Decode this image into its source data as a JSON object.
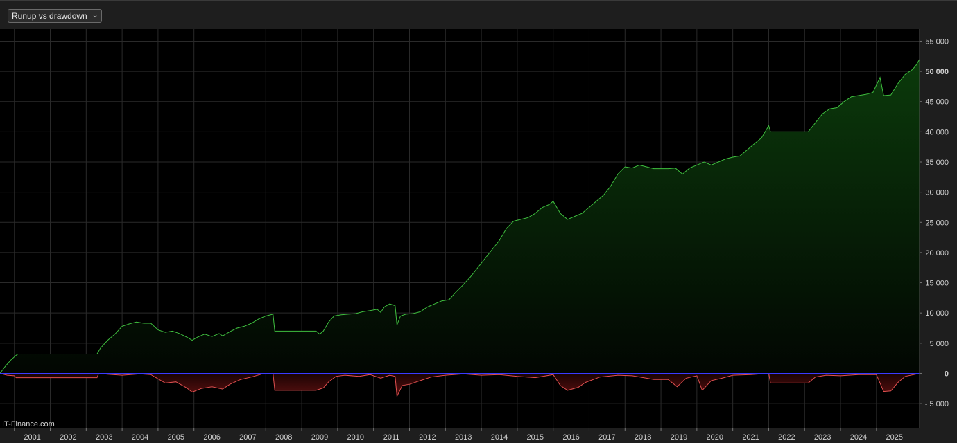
{
  "toolbar": {
    "dropdown_value": "Runup vs drawdown"
  },
  "watermark": "IT-Finance.com",
  "colors": {
    "runup": "#3fbf3f",
    "drawdown": "#e05050",
    "zero_line": "#3a3aff",
    "grid": "#2a2a2a"
  },
  "chart_data": {
    "type": "area",
    "title": "",
    "xlabel": "",
    "ylabel": "",
    "x_ticks": [
      "2001",
      "2002",
      "2003",
      "2004",
      "2005",
      "2006",
      "2007",
      "2008",
      "2009",
      "2010",
      "2011",
      "2012",
      "2013",
      "2014",
      "2015",
      "2016",
      "2017",
      "2018",
      "2019",
      "2020",
      "2021",
      "2022",
      "2023",
      "2024",
      "2025"
    ],
    "y_ticks": [
      {
        "value": 55000,
        "label": "55 000"
      },
      {
        "value": 50000,
        "label": "50 000"
      },
      {
        "value": 45000,
        "label": "45 000"
      },
      {
        "value": 40000,
        "label": "40 000"
      },
      {
        "value": 35000,
        "label": "35 000"
      },
      {
        "value": 30000,
        "label": "30 000"
      },
      {
        "value": 25000,
        "label": "25 000"
      },
      {
        "value": 20000,
        "label": "20 000"
      },
      {
        "value": 15000,
        "label": "15 000"
      },
      {
        "value": 10000,
        "label": "10 000"
      },
      {
        "value": 5000,
        "label": "5 000"
      },
      {
        "value": 0,
        "label": "0"
      },
      {
        "value": -5000,
        "label": "- 5 000"
      }
    ],
    "xlim": [
      2000.6,
      2026.2
    ],
    "ylim": [
      -9000,
      57000
    ],
    "grid": true,
    "legend": "none",
    "series": [
      {
        "values": [
          [
            2000.6,
            0
          ],
          [
            2000.75,
            1200
          ],
          [
            2000.9,
            2200
          ],
          [
            2001.05,
            3000
          ],
          [
            2001.1,
            3200
          ],
          [
            2003.3,
            3200
          ],
          [
            2003.4,
            4200
          ],
          [
            2003.6,
            5500
          ],
          [
            2003.8,
            6500
          ],
          [
            2004.0,
            7800
          ],
          [
            2004.2,
            8200
          ],
          [
            2004.4,
            8500
          ],
          [
            2004.6,
            8300
          ],
          [
            2004.8,
            8300
          ],
          [
            2005.0,
            7200
          ],
          [
            2005.2,
            6800
          ],
          [
            2005.4,
            7000
          ],
          [
            2005.6,
            6600
          ],
          [
            2005.8,
            6000
          ],
          [
            2005.95,
            5500
          ],
          [
            2006.1,
            6000
          ],
          [
            2006.3,
            6500
          ],
          [
            2006.5,
            6100
          ],
          [
            2006.7,
            6600
          ],
          [
            2006.8,
            6200
          ],
          [
            2007.0,
            6900
          ],
          [
            2007.2,
            7500
          ],
          [
            2007.4,
            7800
          ],
          [
            2007.6,
            8300
          ],
          [
            2007.8,
            9000
          ],
          [
            2008.0,
            9500
          ],
          [
            2008.2,
            9800
          ],
          [
            2008.25,
            7000
          ],
          [
            2009.4,
            7000
          ],
          [
            2009.5,
            6500
          ],
          [
            2009.6,
            7000
          ],
          [
            2009.75,
            8500
          ],
          [
            2009.9,
            9500
          ],
          [
            2010.1,
            9700
          ],
          [
            2010.3,
            9800
          ],
          [
            2010.5,
            9900
          ],
          [
            2010.7,
            10200
          ],
          [
            2010.9,
            10400
          ],
          [
            2011.1,
            10600
          ],
          [
            2011.2,
            10100
          ],
          [
            2011.3,
            11000
          ],
          [
            2011.45,
            11500
          ],
          [
            2011.6,
            11200
          ],
          [
            2011.65,
            8000
          ],
          [
            2011.75,
            9500
          ],
          [
            2011.9,
            9800
          ],
          [
            2012.1,
            9900
          ],
          [
            2012.3,
            10200
          ],
          [
            2012.5,
            11000
          ],
          [
            2012.7,
            11500
          ],
          [
            2012.9,
            12000
          ],
          [
            2013.1,
            12200
          ],
          [
            2013.3,
            13500
          ],
          [
            2013.5,
            14700
          ],
          [
            2013.7,
            16000
          ],
          [
            2013.9,
            17500
          ],
          [
            2014.1,
            19000
          ],
          [
            2014.3,
            20500
          ],
          [
            2014.5,
            22000
          ],
          [
            2014.7,
            24000
          ],
          [
            2014.9,
            25200
          ],
          [
            2015.1,
            25500
          ],
          [
            2015.3,
            25800
          ],
          [
            2015.5,
            26500
          ],
          [
            2015.7,
            27500
          ],
          [
            2015.9,
            28000
          ],
          [
            2016.0,
            28500
          ],
          [
            2016.2,
            26500
          ],
          [
            2016.4,
            25500
          ],
          [
            2016.6,
            26000
          ],
          [
            2016.8,
            26500
          ],
          [
            2017.0,
            27500
          ],
          [
            2017.2,
            28500
          ],
          [
            2017.4,
            29500
          ],
          [
            2017.6,
            31000
          ],
          [
            2017.8,
            33000
          ],
          [
            2018.0,
            34200
          ],
          [
            2018.2,
            34000
          ],
          [
            2018.4,
            34500
          ],
          [
            2018.6,
            34200
          ],
          [
            2018.8,
            33900
          ],
          [
            2019.2,
            33900
          ],
          [
            2019.4,
            34000
          ],
          [
            2019.6,
            33000
          ],
          [
            2019.8,
            34000
          ],
          [
            2020.0,
            34500
          ],
          [
            2020.2,
            35000
          ],
          [
            2020.4,
            34500
          ],
          [
            2020.6,
            35000
          ],
          [
            2020.8,
            35500
          ],
          [
            2021.0,
            35800
          ],
          [
            2021.2,
            36000
          ],
          [
            2021.4,
            37000
          ],
          [
            2021.6,
            38000
          ],
          [
            2021.8,
            39000
          ],
          [
            2022.0,
            41000
          ],
          [
            2022.05,
            40000
          ],
          [
            2023.1,
            40000
          ],
          [
            2023.3,
            41500
          ],
          [
            2023.5,
            43000
          ],
          [
            2023.7,
            43800
          ],
          [
            2023.9,
            44000
          ],
          [
            2024.1,
            45000
          ],
          [
            2024.3,
            45800
          ],
          [
            2024.5,
            46000
          ],
          [
            2024.7,
            46200
          ],
          [
            2024.9,
            46500
          ],
          [
            2025.1,
            49000
          ],
          [
            2025.2,
            46000
          ],
          [
            2025.4,
            46100
          ],
          [
            2025.6,
            48000
          ],
          [
            2025.8,
            49500
          ],
          [
            2026.0,
            50300
          ],
          [
            2026.1,
            51000
          ],
          [
            2026.2,
            52000
          ]
        ]
      },
      {
        "values": [
          [
            2000.6,
            0
          ],
          [
            2000.8,
            -300
          ],
          [
            2001.0,
            -400
          ],
          [
            2001.05,
            -700
          ],
          [
            2003.3,
            -700
          ],
          [
            2003.35,
            0
          ],
          [
            2003.6,
            -150
          ],
          [
            2004.0,
            -300
          ],
          [
            2004.5,
            -100
          ],
          [
            2004.8,
            -200
          ],
          [
            2005.0,
            -900
          ],
          [
            2005.2,
            -1600
          ],
          [
            2005.5,
            -1400
          ],
          [
            2005.8,
            -2400
          ],
          [
            2005.95,
            -3100
          ],
          [
            2006.2,
            -2500
          ],
          [
            2006.5,
            -2200
          ],
          [
            2006.8,
            -2600
          ],
          [
            2007.0,
            -1800
          ],
          [
            2007.3,
            -1000
          ],
          [
            2007.6,
            -600
          ],
          [
            2007.9,
            -100
          ],
          [
            2008.2,
            0
          ],
          [
            2008.25,
            -2800
          ],
          [
            2009.4,
            -2800
          ],
          [
            2009.6,
            -2400
          ],
          [
            2009.75,
            -1400
          ],
          [
            2009.95,
            -500
          ],
          [
            2010.2,
            -300
          ],
          [
            2010.6,
            -500
          ],
          [
            2010.9,
            -200
          ],
          [
            2011.2,
            -800
          ],
          [
            2011.45,
            -300
          ],
          [
            2011.6,
            -500
          ],
          [
            2011.65,
            -3800
          ],
          [
            2011.8,
            -2000
          ],
          [
            2012.0,
            -1800
          ],
          [
            2012.3,
            -1200
          ],
          [
            2012.6,
            -600
          ],
          [
            2013.0,
            -300
          ],
          [
            2013.5,
            -100
          ],
          [
            2014.0,
            -300
          ],
          [
            2014.5,
            -200
          ],
          [
            2015.0,
            -500
          ],
          [
            2015.5,
            -700
          ],
          [
            2016.0,
            -200
          ],
          [
            2016.2,
            -2000
          ],
          [
            2016.4,
            -2800
          ],
          [
            2016.7,
            -2300
          ],
          [
            2016.9,
            -1500
          ],
          [
            2017.3,
            -600
          ],
          [
            2017.8,
            -300
          ],
          [
            2018.2,
            -400
          ],
          [
            2018.6,
            -800
          ],
          [
            2018.8,
            -1000
          ],
          [
            2019.2,
            -1000
          ],
          [
            2019.45,
            -2200
          ],
          [
            2019.7,
            -800
          ],
          [
            2020.0,
            -400
          ],
          [
            2020.15,
            -2800
          ],
          [
            2020.4,
            -1200
          ],
          [
            2020.7,
            -800
          ],
          [
            2021.0,
            -300
          ],
          [
            2021.5,
            -200
          ],
          [
            2022.0,
            0
          ],
          [
            2022.05,
            -1600
          ],
          [
            2023.1,
            -1600
          ],
          [
            2023.3,
            -600
          ],
          [
            2023.6,
            -300
          ],
          [
            2024.0,
            -400
          ],
          [
            2024.5,
            -200
          ],
          [
            2025.0,
            -200
          ],
          [
            2025.2,
            -3000
          ],
          [
            2025.4,
            -2900
          ],
          [
            2025.6,
            -1500
          ],
          [
            2025.8,
            -500
          ],
          [
            2026.2,
            0
          ]
        ]
      }
    ]
  }
}
